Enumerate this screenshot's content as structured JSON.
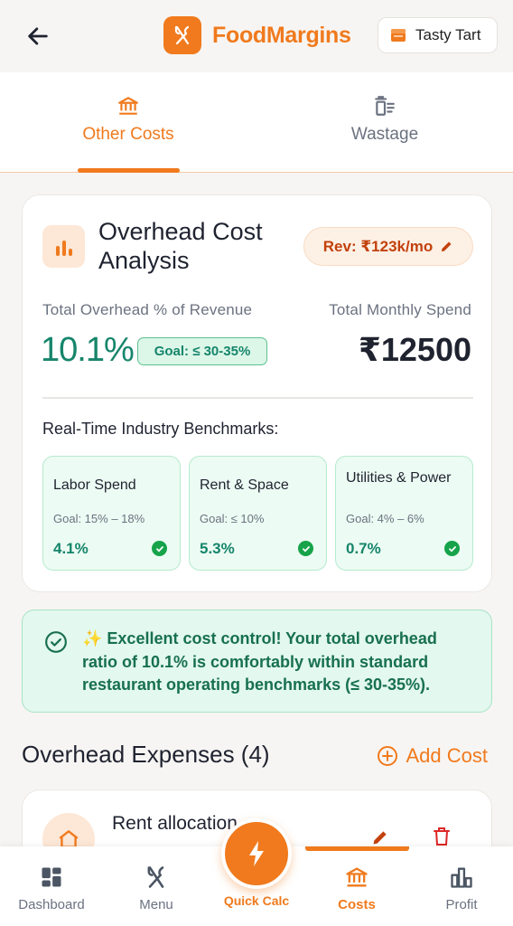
{
  "header": {
    "app_name": "FoodMargins",
    "store_name": "Tasty Tart",
    "icons": {
      "back": "arrow-left-icon",
      "logo": "fork-knife-icon",
      "store": "storefront-icon"
    }
  },
  "tabs": [
    {
      "label": "Other Costs",
      "icon": "bank-icon",
      "active": true
    },
    {
      "label": "Wastage",
      "icon": "trash-list-icon",
      "active": false
    }
  ],
  "overview": {
    "title": "Overhead Cost Analysis",
    "revenue_chip": "Rev: ₹123k/mo",
    "overhead_label": "Total Overhead % of Revenue",
    "overhead_value": "10.1%",
    "goal": "Goal: ≤ 30-35%",
    "spend_label": "Total Monthly Spend",
    "spend_value": "₹12500",
    "benchmarks_title": "Real-Time Industry Benchmarks:",
    "benchmarks": [
      {
        "name": "Labor Spend",
        "goal": "Goal: 15% – 18%",
        "value": "4.1%"
      },
      {
        "name": "Rent & Space",
        "goal": "Goal: ≤ 10%",
        "value": "5.3%"
      },
      {
        "name": "Utilities & Power",
        "goal": "Goal: 4% – 6%",
        "value": "0.7%"
      }
    ]
  },
  "alert": {
    "text": "✨ Excellent cost control! Your total overhead ratio of 10.1% is comfortably within standard restaurant operating benchmarks (≤ 30-35%)."
  },
  "expenses": {
    "title": "Overhead Expenses (4)",
    "add_label": "Add Cost",
    "items": [
      {
        "name": "Rent allocation"
      }
    ]
  },
  "bottom_nav": [
    {
      "label": "Dashboard",
      "icon": "dashboard-icon",
      "active": false
    },
    {
      "label": "Menu",
      "icon": "fork-knife-icon",
      "active": false
    },
    {
      "label": "Quick Calc",
      "icon": "lightning-icon",
      "active": false
    },
    {
      "label": "Costs",
      "icon": "bank-icon",
      "active": true
    },
    {
      "label": "Profit",
      "icon": "bar-chart-icon",
      "active": false
    }
  ],
  "colors": {
    "accent": "#f07a1d",
    "success": "#16856b",
    "success_bg": "#e3f8ee",
    "text": "#1f2330",
    "muted": "#6b7280"
  }
}
